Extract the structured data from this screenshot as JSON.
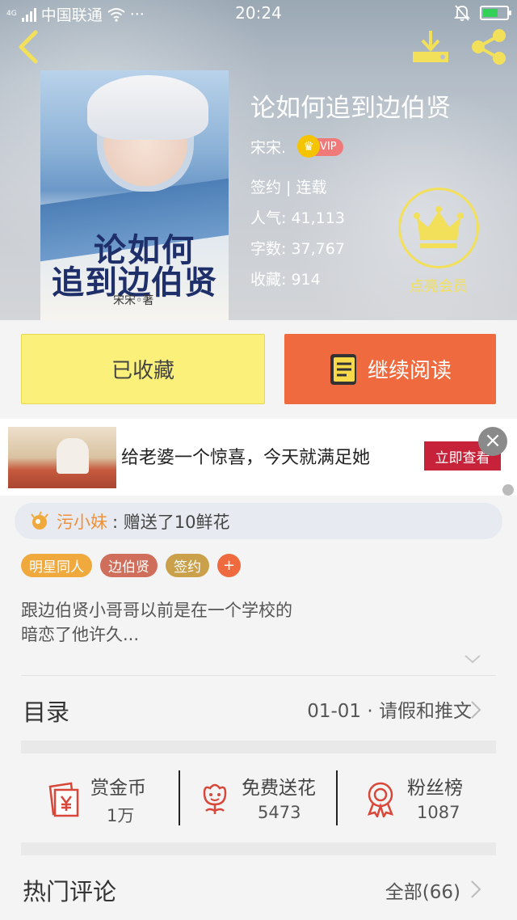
{
  "status_bar": {
    "network": "4G",
    "carrier": "中国联通",
    "dots": "···",
    "time": "20:24"
  },
  "book": {
    "title": "论如何追到边伯贤",
    "author": "宋宋.",
    "vip_label": "VIP",
    "status": "签约 | 连载",
    "popularity_label": "人气:",
    "popularity": "41,113",
    "words_label": "字数:",
    "words": "37,767",
    "favorites_label": "收藏:",
    "favorites": "914",
    "cover_title_line1": "论如何",
    "cover_title_line2": "追到边伯贤",
    "cover_author": "宋宋◦著"
  },
  "member": {
    "label": "点亮会员"
  },
  "actions": {
    "favorited_label": "已收藏",
    "continue_label": "继续阅读"
  },
  "ad": {
    "text": "给老婆一个惊喜，今天就满足她",
    "cta": "立即查看"
  },
  "gift": {
    "user": "污小妹",
    "message": ": 赠送了10鲜花"
  },
  "tags": [
    {
      "label": "明星同人",
      "color": "#f0a93c"
    },
    {
      "label": "边伯贤",
      "color": "#cf6e5a"
    },
    {
      "label": "签约",
      "color": "#caa04a"
    }
  ],
  "tag_add": "+",
  "description": {
    "line1": "跟边伯贤小哥哥以前是在一个学校的",
    "line2": "暗恋了他许久..."
  },
  "catalog": {
    "title": "目录",
    "latest": "01-01 · 请假和推文"
  },
  "stats": {
    "reward": {
      "name": "赏金币",
      "count": "1万"
    },
    "flowers": {
      "name": "免费送花",
      "count": "5473"
    },
    "fans": {
      "name": "粉丝榜",
      "count": "1087"
    }
  },
  "comments": {
    "title": "热门评论",
    "all": "全部(66)"
  },
  "colors": {
    "accent_orange": "#ef6a3e",
    "favorite_yellow": "#fbf17a",
    "member_gold": "#f3e05a",
    "icon_red": "#d8473a"
  }
}
